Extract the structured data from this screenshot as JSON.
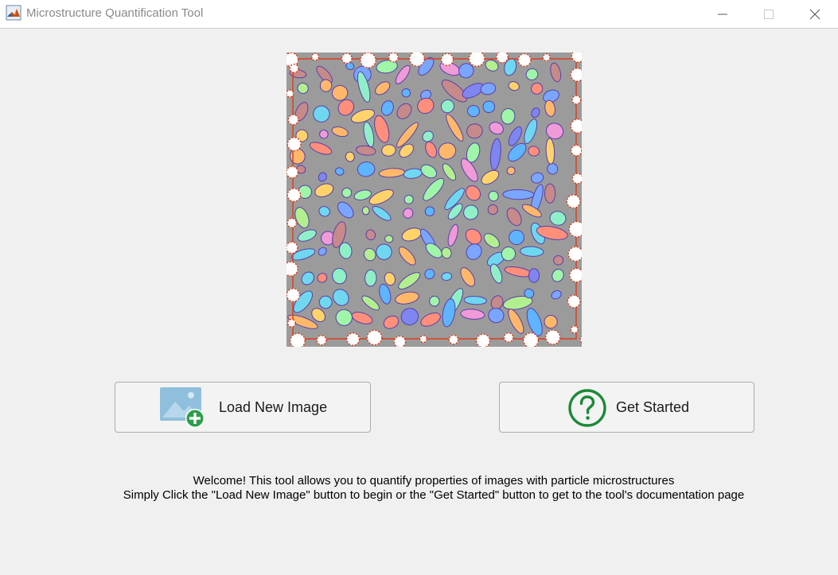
{
  "window": {
    "title": "Microstructure Quantification Tool",
    "app_icon": "matlab-icon",
    "controls": [
      "minimize-icon",
      "maximize-icon",
      "close-icon"
    ]
  },
  "preview": {
    "icon": "segmented-particle-image",
    "colors": {
      "background": "#9b9b9b",
      "boundary": "#d9401f",
      "particle_outline": "#5a3fa8"
    }
  },
  "buttons": {
    "load": {
      "label": "Load New Image",
      "icon": "add-image-icon",
      "accent": "#2e9d4a"
    },
    "start": {
      "label": "Get Started",
      "icon": "help-circle-icon",
      "accent": "#1c8a3a"
    }
  },
  "welcome": {
    "line1": "Welcome! This tool allows you to quantify properties of images with particle microstructures",
    "line2": "Simply Click the \"Load New Image\" button to begin or the \"Get Started\" button to get to the tool's documentation page"
  }
}
